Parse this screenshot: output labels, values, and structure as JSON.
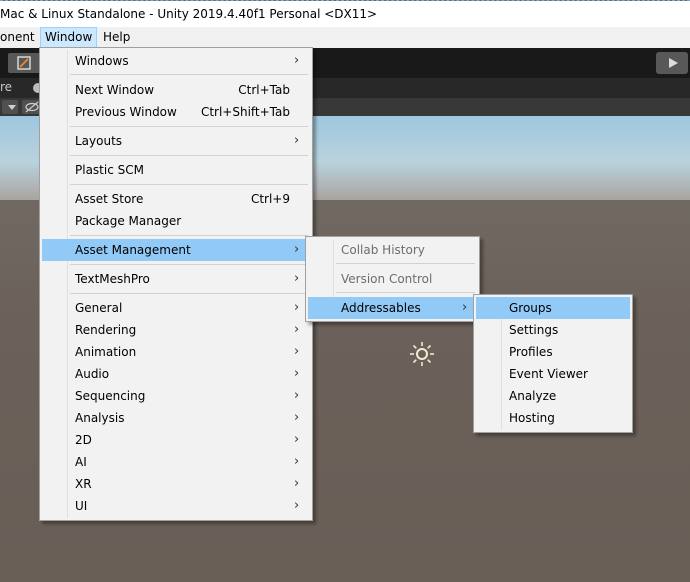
{
  "title_bar": {
    "text": "Mac & Linux Standalone - Unity 2019.4.40f1 Personal <DX11>"
  },
  "menu_bar": {
    "items": [
      "onent",
      "Window",
      "Help"
    ]
  },
  "toolbar": {
    "tab_fragment": "re"
  },
  "window_menu": {
    "items": [
      {
        "label": "Windows",
        "submenu": true
      },
      {
        "label": "Next Window",
        "shortcut": "Ctrl+Tab"
      },
      {
        "label": "Previous Window",
        "shortcut": "Ctrl+Shift+Tab"
      },
      {
        "label": "Layouts",
        "submenu": true
      },
      {
        "label": "Plastic SCM"
      },
      {
        "label": "Asset Store",
        "shortcut": "Ctrl+9"
      },
      {
        "label": "Package Manager"
      },
      {
        "label": "Asset Management",
        "submenu": true
      },
      {
        "label": "TextMeshPro",
        "submenu": true
      },
      {
        "label": "General",
        "submenu": true
      },
      {
        "label": "Rendering",
        "submenu": true
      },
      {
        "label": "Animation",
        "submenu": true
      },
      {
        "label": "Audio",
        "submenu": true
      },
      {
        "label": "Sequencing",
        "submenu": true
      },
      {
        "label": "Analysis",
        "submenu": true
      },
      {
        "label": "2D",
        "submenu": true
      },
      {
        "label": "AI",
        "submenu": true
      },
      {
        "label": "XR",
        "submenu": true
      },
      {
        "label": "UI",
        "submenu": true
      }
    ]
  },
  "asset_management_menu": {
    "items": [
      {
        "label": "Collab History",
        "disabled": true
      },
      {
        "label": "Version Control",
        "disabled": true
      },
      {
        "label": "Addressables",
        "submenu": true
      }
    ]
  },
  "addressables_menu": {
    "items": [
      {
        "label": "Groups"
      },
      {
        "label": "Settings"
      },
      {
        "label": "Profiles"
      },
      {
        "label": "Event Viewer"
      },
      {
        "label": "Analyze"
      },
      {
        "label": "Hosting"
      }
    ]
  },
  "icons": {
    "chevron": "›",
    "sun": "directional-light-icon"
  },
  "colors": {
    "highlight": "#91c9f7",
    "menu_bg": "#f2f2f2",
    "toolbar_bg": "#191919"
  }
}
